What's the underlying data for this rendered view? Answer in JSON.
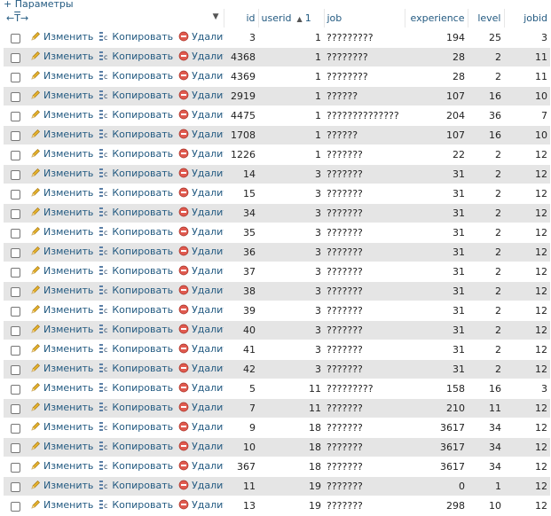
{
  "options_label": "+ Параметры",
  "toolbar": {
    "arrows_left": "←",
    "arrows_mid": "T",
    "arrows_right": "→"
  },
  "labels": {
    "edit": "Изменить",
    "copy": "Копировать",
    "delete": "Удалить"
  },
  "columns": {
    "id": "id",
    "userid": "userid",
    "userid_sort_num": "1",
    "job": "job",
    "experience": "experience",
    "level": "level",
    "jobid": "jobid"
  },
  "colors": {
    "link": "#235a81",
    "row_alt": "#e5e5e5",
    "edit_icon": "#e5b22b",
    "delete_icon": "#e05a4f"
  },
  "rows": [
    {
      "id": "3",
      "userid": "1",
      "job": "?????????",
      "experience": "194",
      "level": "25",
      "jobid": "3"
    },
    {
      "id": "4368",
      "userid": "1",
      "job": "????????",
      "experience": "28",
      "level": "2",
      "jobid": "11"
    },
    {
      "id": "4369",
      "userid": "1",
      "job": "????????",
      "experience": "28",
      "level": "2",
      "jobid": "11"
    },
    {
      "id": "2919",
      "userid": "1",
      "job": "??????",
      "experience": "107",
      "level": "16",
      "jobid": "10"
    },
    {
      "id": "4475",
      "userid": "1",
      "job": "??????????????",
      "experience": "204",
      "level": "36",
      "jobid": "7"
    },
    {
      "id": "1708",
      "userid": "1",
      "job": "??????",
      "experience": "107",
      "level": "16",
      "jobid": "10"
    },
    {
      "id": "1226",
      "userid": "1",
      "job": "???????",
      "experience": "22",
      "level": "2",
      "jobid": "12"
    },
    {
      "id": "14",
      "userid": "3",
      "job": "???????",
      "experience": "31",
      "level": "2",
      "jobid": "12"
    },
    {
      "id": "15",
      "userid": "3",
      "job": "???????",
      "experience": "31",
      "level": "2",
      "jobid": "12"
    },
    {
      "id": "34",
      "userid": "3",
      "job": "???????",
      "experience": "31",
      "level": "2",
      "jobid": "12"
    },
    {
      "id": "35",
      "userid": "3",
      "job": "???????",
      "experience": "31",
      "level": "2",
      "jobid": "12"
    },
    {
      "id": "36",
      "userid": "3",
      "job": "???????",
      "experience": "31",
      "level": "2",
      "jobid": "12"
    },
    {
      "id": "37",
      "userid": "3",
      "job": "???????",
      "experience": "31",
      "level": "2",
      "jobid": "12"
    },
    {
      "id": "38",
      "userid": "3",
      "job": "???????",
      "experience": "31",
      "level": "2",
      "jobid": "12"
    },
    {
      "id": "39",
      "userid": "3",
      "job": "???????",
      "experience": "31",
      "level": "2",
      "jobid": "12"
    },
    {
      "id": "40",
      "userid": "3",
      "job": "???????",
      "experience": "31",
      "level": "2",
      "jobid": "12"
    },
    {
      "id": "41",
      "userid": "3",
      "job": "???????",
      "experience": "31",
      "level": "2",
      "jobid": "12"
    },
    {
      "id": "42",
      "userid": "3",
      "job": "???????",
      "experience": "31",
      "level": "2",
      "jobid": "12"
    },
    {
      "id": "5",
      "userid": "11",
      "job": "?????????",
      "experience": "158",
      "level": "16",
      "jobid": "3"
    },
    {
      "id": "7",
      "userid": "11",
      "job": "???????",
      "experience": "210",
      "level": "11",
      "jobid": "12"
    },
    {
      "id": "9",
      "userid": "18",
      "job": "???????",
      "experience": "3617",
      "level": "34",
      "jobid": "12"
    },
    {
      "id": "10",
      "userid": "18",
      "job": "???????",
      "experience": "3617",
      "level": "34",
      "jobid": "12"
    },
    {
      "id": "367",
      "userid": "18",
      "job": "???????",
      "experience": "3617",
      "level": "34",
      "jobid": "12"
    },
    {
      "id": "11",
      "userid": "19",
      "job": "???????",
      "experience": "0",
      "level": "1",
      "jobid": "12"
    },
    {
      "id": "13",
      "userid": "19",
      "job": "???????",
      "experience": "298",
      "level": "10",
      "jobid": "12"
    }
  ]
}
